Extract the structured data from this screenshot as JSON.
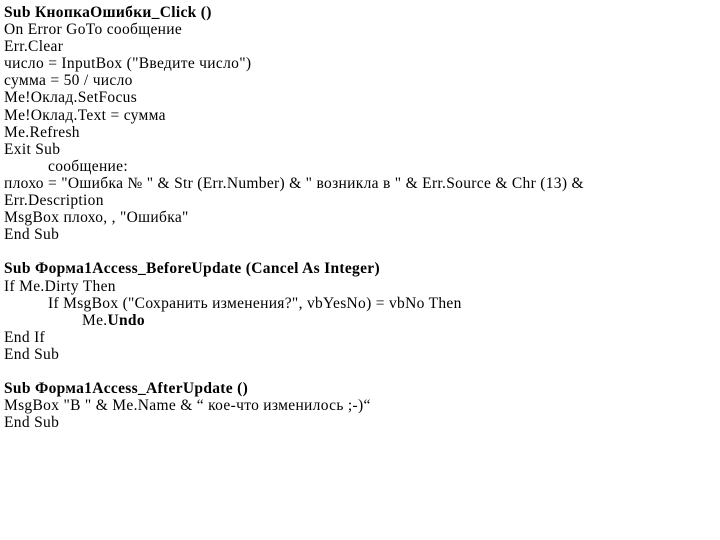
{
  "document": {
    "title": "VBA Code Listing",
    "background_color": "#ffffff",
    "text_color": "#000000"
  },
  "procedures": [
    {
      "name": "КнопкаОшибки_Click",
      "lines": [
        {
          "text": "Sub КнопкаОшибки_Click ()",
          "bold": true,
          "indent": 0
        },
        {
          "text": "On Error GoTo сообщение",
          "bold": false,
          "indent": 0
        },
        {
          "text": "Err.Clear",
          "bold": false,
          "indent": 0
        },
        {
          "text": "число = InputBox (\"Введите число\")",
          "bold": false,
          "indent": 0
        },
        {
          "text": "сумма = 50 / число",
          "bold": false,
          "indent": 0
        },
        {
          "text": "Me!Оклад.SetFocus",
          "bold": false,
          "indent": 0
        },
        {
          "text": "Me!Оклад.Text = сумма",
          "bold": false,
          "indent": 0
        },
        {
          "text": "Me.Refresh",
          "bold": false,
          "indent": 0
        },
        {
          "text": "Exit Sub",
          "bold": false,
          "indent": 0
        },
        {
          "text": "сообщение:",
          "bold": false,
          "indent": 1
        },
        {
          "text": "плохо = \"Ошибка № \" & Str (Err.Number) & \" возникла в \" & Err.Source & Chr (13) &",
          "bold": false,
          "indent": 0
        },
        {
          "text": "Err.Description",
          "bold": false,
          "indent": 0
        },
        {
          "text": "MsgBox плохо, , \"Ошибка\"",
          "bold": false,
          "indent": 0
        },
        {
          "text": "End Sub",
          "bold": false,
          "indent": 0
        }
      ]
    },
    {
      "name": "Форма1Access_BeforeUpdate",
      "lines": [
        {
          "text": "Sub Форма1Access_BeforeUpdate (Cancel As Integer)",
          "bold": true,
          "indent": 0
        },
        {
          "text": "If Me.Dirty Then",
          "bold": false,
          "indent": 0
        },
        {
          "text": "If MsgBox (\"Сохранить изменения?\", vbYesNo) = vbNo Then",
          "bold": false,
          "indent": 1
        },
        {
          "text": "Me.Undo",
          "bold": false,
          "indent": 2,
          "bold_suffix": "Undo",
          "plain_prefix": "Me."
        },
        {
          "text": "End If",
          "bold": false,
          "indent": 0
        },
        {
          "text": "End Sub",
          "bold": false,
          "indent": 0
        }
      ]
    },
    {
      "name": "Форма1Access_AfterUpdate",
      "lines": [
        {
          "text": "Sub Форма1Access_AfterUpdate ()",
          "bold": true,
          "indent": 0
        },
        {
          "text": "MsgBox \"В \" & Me.Name & “ кое-что изменилось ;-)“",
          "bold": false,
          "indent": 0
        },
        {
          "text": "End Sub",
          "bold": false,
          "indent": 0
        }
      ]
    }
  ]
}
